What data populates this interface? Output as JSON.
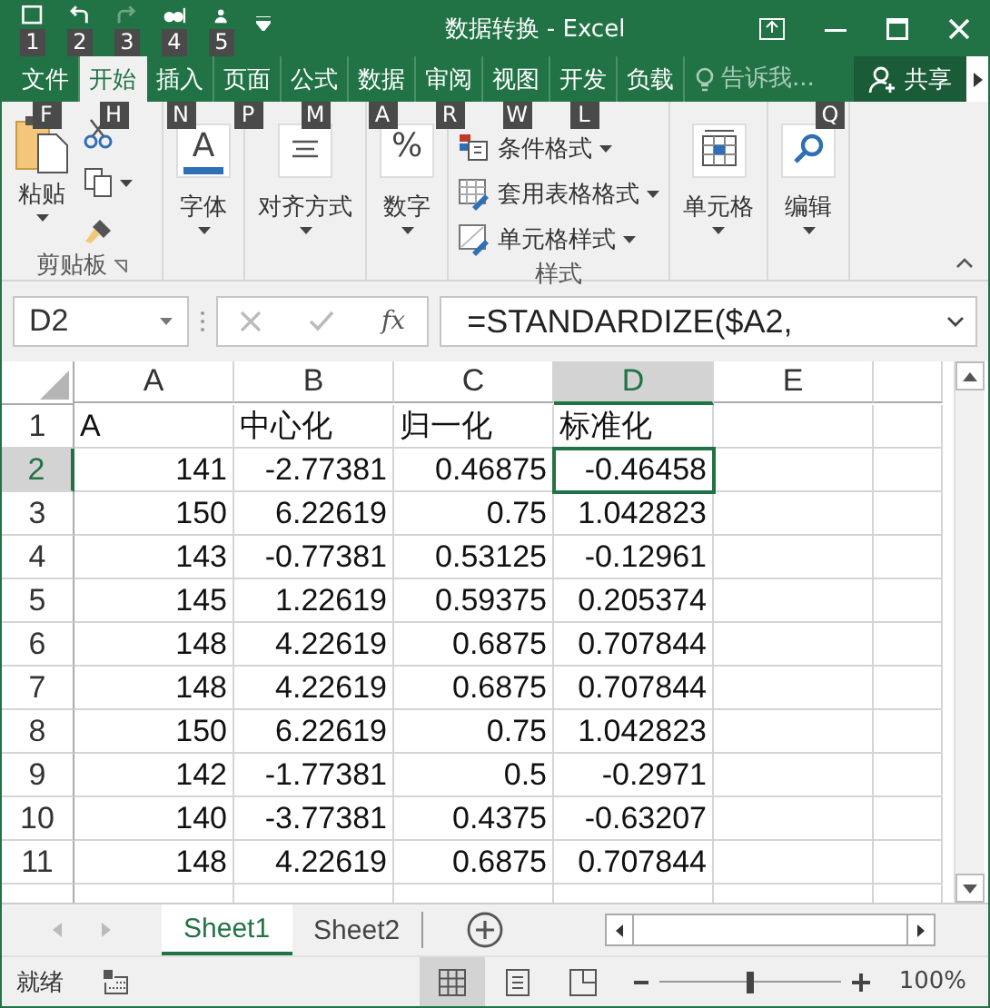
{
  "window": {
    "title": "数据转换 - Excel"
  },
  "quick_access": [
    {
      "kind": "save",
      "keytip": "1",
      "disabled": false
    },
    {
      "kind": "undo",
      "keytip": "2",
      "disabled": false
    },
    {
      "kind": "redo",
      "keytip": "3",
      "disabled": true
    },
    {
      "kind": "preview",
      "keytip": "4",
      "disabled": false
    },
    {
      "kind": "touch",
      "keytip": "5",
      "disabled": false
    }
  ],
  "ribbon_tabs": [
    {
      "label": "文件",
      "keytip": "F",
      "selected": false
    },
    {
      "label": "开始",
      "keytip": "H",
      "selected": true
    },
    {
      "label": "插入",
      "keytip": "N",
      "selected": false
    },
    {
      "label": "页面",
      "keytip": "P",
      "selected": false
    },
    {
      "label": "公式",
      "keytip": "M",
      "selected": false
    },
    {
      "label": "数据",
      "keytip": "A",
      "selected": false
    },
    {
      "label": "审阅",
      "keytip": "R",
      "selected": false
    },
    {
      "label": "视图",
      "keytip": "W",
      "selected": false
    },
    {
      "label": "开发",
      "keytip": "L",
      "selected": false
    },
    {
      "label": "负载",
      "selected": false
    }
  ],
  "tell_me": {
    "placeholder": "告诉我...",
    "keytip": "Q"
  },
  "share": "共享",
  "ribbon": {
    "groups": [
      {
        "kind": "clipboard",
        "label": "剪贴板",
        "paste": "粘贴"
      },
      {
        "kind": "font",
        "button": "字体",
        "glyph": "A"
      },
      {
        "kind": "align",
        "button": "对齐方式"
      },
      {
        "kind": "number",
        "button": "数字",
        "glyph": "%"
      },
      {
        "kind": "styles",
        "label": "样式",
        "items": [
          "条件格式",
          "套用表格格式",
          "单元格样式"
        ]
      },
      {
        "kind": "cells",
        "button": "单元格"
      },
      {
        "kind": "editing",
        "button": "编辑"
      }
    ]
  },
  "formula_bar": {
    "name_box": "D2",
    "function_button": "fx",
    "formula": "=STANDARDIZE($A2,"
  },
  "grid": {
    "columns": [
      {
        "label": "A",
        "selected": false
      },
      {
        "label": "B",
        "selected": false
      },
      {
        "label": "C",
        "selected": false
      },
      {
        "label": "D",
        "selected": true
      },
      {
        "label": "E",
        "selected": false
      }
    ],
    "rows": [
      {
        "header": "1",
        "selected": false,
        "kind": "text",
        "cells": [
          "A",
          "中心化",
          "归一化",
          "标准化"
        ]
      },
      {
        "header": "2",
        "selected": true,
        "kind": "number",
        "cells": [
          "141",
          "-2.77381",
          "0.46875",
          "-0.46458"
        ]
      },
      {
        "header": "3",
        "selected": false,
        "kind": "number",
        "cells": [
          "150",
          "6.22619",
          "0.75",
          "1.042823"
        ]
      },
      {
        "header": "4",
        "selected": false,
        "kind": "number",
        "cells": [
          "143",
          "-0.77381",
          "0.53125",
          "-0.12961"
        ]
      },
      {
        "header": "5",
        "selected": false,
        "kind": "number",
        "cells": [
          "145",
          "1.22619",
          "0.59375",
          "0.205374"
        ]
      },
      {
        "header": "6",
        "selected": false,
        "kind": "number",
        "cells": [
          "148",
          "4.22619",
          "0.6875",
          "0.707844"
        ]
      },
      {
        "header": "7",
        "selected": false,
        "kind": "number",
        "cells": [
          "148",
          "4.22619",
          "0.6875",
          "0.707844"
        ]
      },
      {
        "header": "8",
        "selected": false,
        "kind": "number",
        "cells": [
          "150",
          "6.22619",
          "0.75",
          "1.042823"
        ]
      },
      {
        "header": "9",
        "selected": false,
        "kind": "number",
        "cells": [
          "142",
          "-1.77381",
          "0.5",
          "-0.2971"
        ]
      },
      {
        "header": "10",
        "selected": false,
        "kind": "number",
        "cells": [
          "140",
          "-3.77381",
          "0.4375",
          "-0.63207"
        ]
      },
      {
        "header": "11",
        "selected": false,
        "kind": "number",
        "cells": [
          "148",
          "4.22619",
          "0.6875",
          "0.707844"
        ]
      }
    ]
  },
  "sheet_tabs": [
    {
      "label": "Sheet1",
      "selected": true
    },
    {
      "label": "Sheet2",
      "selected": false
    }
  ],
  "status_bar": {
    "text": "就绪",
    "views": [
      {
        "kind": "normal",
        "selected": true
      },
      {
        "kind": "page_layout",
        "selected": false
      },
      {
        "kind": "page_break",
        "selected": false
      }
    ],
    "zoom": {
      "level": 0.5,
      "reading": "100%"
    }
  }
}
